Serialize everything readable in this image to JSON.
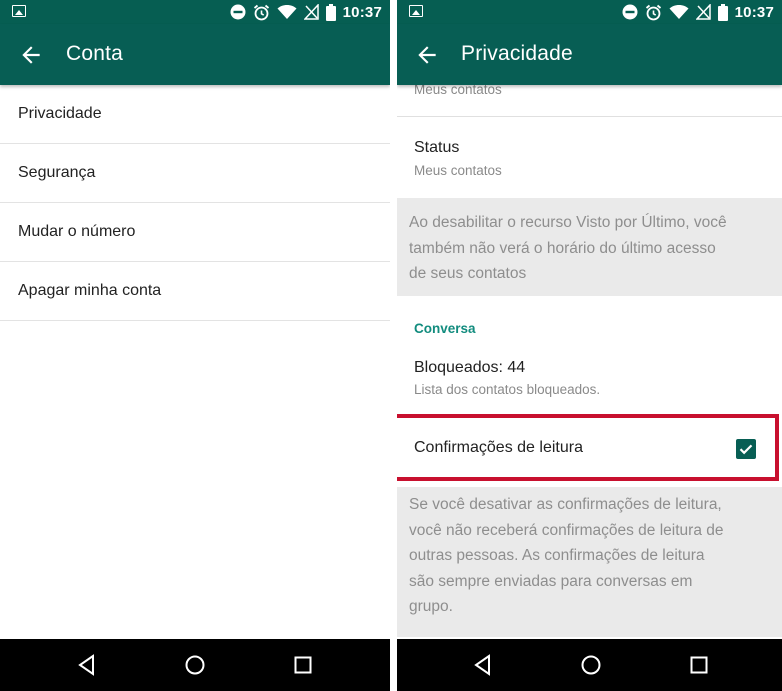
{
  "status_bar": {
    "time": "10:37"
  },
  "left": {
    "title": "Conta",
    "items": [
      "Privacidade",
      "Segurança",
      "Mudar o número",
      "Apagar minha conta"
    ]
  },
  "right": {
    "title": "Privacidade",
    "clipped_subtitle": "Meus contatos",
    "status": {
      "title": "Status",
      "subtitle": "Meus contatos"
    },
    "last_seen_note": [
      "Ao desabilitar o recurso Visto por Último, você",
      "também não verá o horário do último acesso",
      "de seus contatos"
    ],
    "section_conversa": "Conversa",
    "blocked": {
      "title": "Bloqueados: 44",
      "subtitle": "Lista dos contatos bloqueados."
    },
    "read_receipts": {
      "title": "Confirmações de leitura",
      "checked": true
    },
    "read_receipts_note": [
      "Se você desativar as confirmações de leitura,",
      "você não receberá confirmações de leitura de",
      "outras pessoas. As confirmações de leitura",
      "são sempre enviadas para conversas em",
      "grupo."
    ]
  },
  "colors": {
    "primary": "#075e54",
    "statusbar": "#065e52",
    "accent": "#128c7e",
    "highlight": "#c8102e"
  },
  "icons": [
    "back-arrow-icon",
    "gallery-icon",
    "dnd-icon",
    "alarm-icon",
    "wifi-icon",
    "no-signal-icon",
    "battery-icon",
    "nav-back-icon",
    "nav-home-icon",
    "nav-recents-icon",
    "check-icon"
  ]
}
